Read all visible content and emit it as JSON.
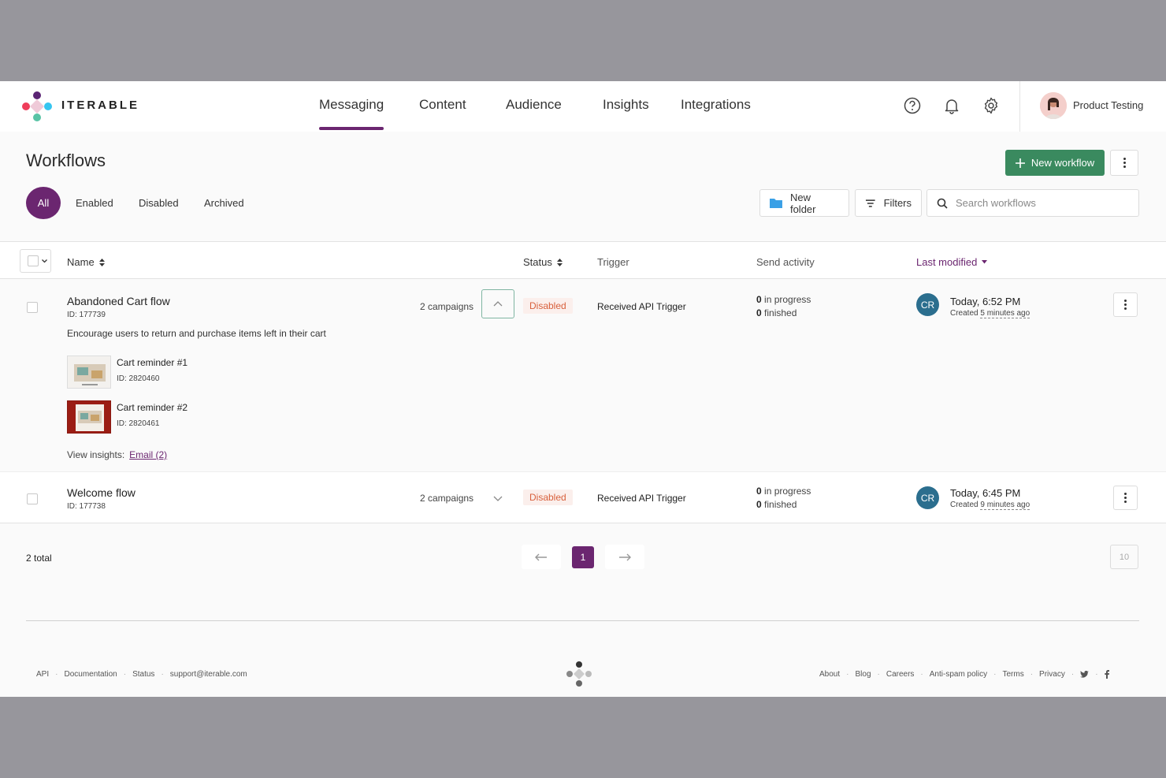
{
  "brand": {
    "name": "ITERABLE"
  },
  "nav": {
    "tabs": [
      {
        "label": "Messaging",
        "active": true
      },
      {
        "label": "Content"
      },
      {
        "label": "Audience"
      },
      {
        "label": "Insights"
      },
      {
        "label": "Integrations"
      }
    ]
  },
  "header_icons": [
    "help-icon",
    "bell-icon",
    "gear-icon"
  ],
  "user": {
    "name": "Product Testing"
  },
  "page": {
    "title": "Workflows",
    "new_button": "New workflow"
  },
  "filters": {
    "tabs": [
      "All",
      "Enabled",
      "Disabled",
      "Archived"
    ],
    "active": "All",
    "new_folder": "New folder",
    "filters_label": "Filters",
    "search_placeholder": "Search workflows"
  },
  "table": {
    "columns": {
      "name": "Name",
      "status": "Status",
      "trigger": "Trigger",
      "activity": "Send activity",
      "modified": "Last modified"
    },
    "rows": [
      {
        "name": "Abandoned Cart flow",
        "id": "ID: 177739",
        "description": "Encourage users to return and purchase items left in their cart",
        "campaigns": "2 campaigns",
        "status": "Disabled",
        "trigger": "Received API Trigger",
        "in_progress_count": "0",
        "in_progress_label": "in progress",
        "finished_count": "0",
        "finished_label": "finished",
        "initials": "CR",
        "modified": "Today, 6:52 PM",
        "created_prefix": "Created",
        "created_ago": "5 minutes ago",
        "expanded": true,
        "campaign_list": [
          {
            "name": "Cart reminder #1",
            "id": "ID: 2820460"
          },
          {
            "name": "Cart reminder #2",
            "id": "ID: 2820461"
          }
        ],
        "insights_label": "View insights:",
        "insights_link": "Email (2)"
      },
      {
        "name": "Welcome flow",
        "id": "ID: 177738",
        "campaigns": "2 campaigns",
        "status": "Disabled",
        "trigger": "Received API Trigger",
        "in_progress_count": "0",
        "in_progress_label": "in progress",
        "finished_count": "0",
        "finished_label": "finished",
        "initials": "CR",
        "modified": "Today, 6:45 PM",
        "created_prefix": "Created",
        "created_ago": "9 minutes ago",
        "expanded": false
      }
    ]
  },
  "pagination": {
    "total": "2 total",
    "current": "1",
    "per_page": "10"
  },
  "footer": {
    "left": [
      "API",
      "Documentation",
      "Status",
      "support@iterable.com"
    ],
    "right": [
      "About",
      "Blog",
      "Careers",
      "Anti-spam policy",
      "Terms",
      "Privacy"
    ],
    "social_icons": [
      "twitter-icon",
      "facebook-icon"
    ]
  },
  "colors": {
    "brand_purple": "#6b2670",
    "primary_green": "#3a8a5f",
    "disabled_red": "#d8603c",
    "avatar_blue": "#2b6e8e"
  }
}
